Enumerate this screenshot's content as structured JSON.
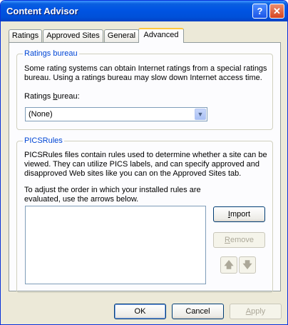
{
  "window": {
    "title": "Content Advisor",
    "help_glyph": "?",
    "close_glyph": "✕"
  },
  "tabs": [
    {
      "label": "Ratings"
    },
    {
      "label": "Approved Sites"
    },
    {
      "label": "General"
    },
    {
      "label": "Advanced",
      "active": true
    }
  ],
  "ratings_bureau": {
    "legend": "Ratings bureau",
    "description_line1": "Some rating systems can obtain Internet ratings from a special ratings",
    "description_line2": "bureau. Using a ratings bureau may slow down Internet access time.",
    "label_pre": "Ratings ",
    "label_accel": "b",
    "label_post": "ureau:",
    "selected": "(None)"
  },
  "pics_rules": {
    "legend": "PICSRules",
    "description_line1": "PICSRules files contain rules used to determine whether a site can be",
    "description_line2": "viewed.  They can utilize PICS labels, and can specify approved and",
    "description_line3": "disapproved Web sites like you can on the Approved Sites tab.",
    "order_line1": "To adjust the order in which your installed rules are",
    "order_line2": "evaluated, use the arrows below.",
    "import_accel": "I",
    "import_rest": "mport",
    "remove_accel": "R",
    "remove_rest": "emove",
    "up_glyph": "🡅",
    "down_glyph": "🡇"
  },
  "footer": {
    "ok": "OK",
    "cancel": "Cancel",
    "apply_accel": "A",
    "apply_rest": "pply"
  }
}
